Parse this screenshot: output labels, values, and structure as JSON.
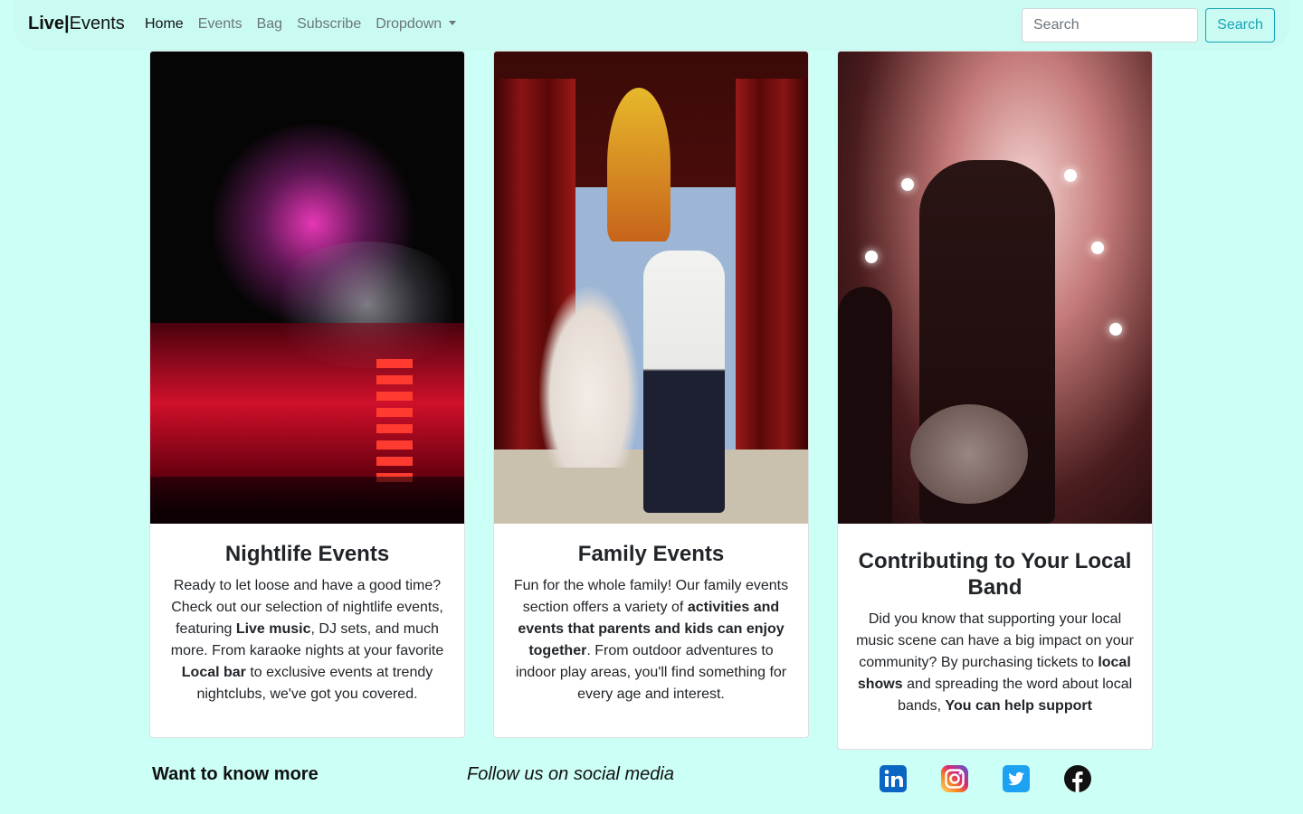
{
  "navbar": {
    "brand_bold": "Live|",
    "brand_rest": "Events",
    "links": [
      "Home",
      "Events",
      "Bag",
      "Subscribe",
      "Dropdown"
    ],
    "search_placeholder": "Search",
    "search_button": "Search"
  },
  "cards": [
    {
      "title": "Nightlife Events",
      "text_parts": [
        "Ready to let loose and have a good time? Check out our selection of nightlife events, featuring ",
        "Live music",
        ", DJ sets, and much more. From karaoke nights at your favorite ",
        "Local bar",
        " to exclusive events at trendy nightclubs, we've got you covered."
      ]
    },
    {
      "title": "Family Events",
      "text_parts": [
        "Fun for the whole family! Our family events section offers a variety of ",
        "activities and events that parents and kids can enjoy together",
        ". From outdoor adventures to indoor play areas, you'll find something for every age and interest."
      ]
    },
    {
      "title": "Contributing to Your Local Band",
      "text_parts": [
        "Did you know that supporting your local music scene can have a big impact on your community? By purchasing tickets to ",
        "local shows",
        " and spreading the word about local bands, ",
        "You can help support"
      ]
    }
  ],
  "footer": {
    "title": "Want to know more",
    "follow": "Follow us on social media",
    "social_icons": [
      "linkedin-icon",
      "instagram-icon",
      "twitter-icon",
      "facebook-icon"
    ]
  },
  "colors": {
    "background": "#ccfff6",
    "navbar": "#c9fbf3",
    "accent": "#17a2b8"
  }
}
